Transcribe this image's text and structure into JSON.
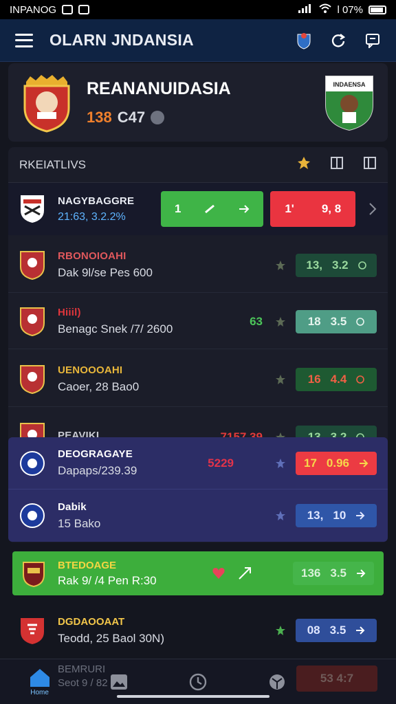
{
  "status_bar": {
    "left_text": "INPANOG",
    "right_text": "l 07%"
  },
  "app_bar": {
    "title": "OLARN JNDANSIA"
  },
  "team_card": {
    "name": "REANANUIDASIA",
    "stat_a": "138",
    "stat_b": "C47",
    "flag_label": "INDAENSA"
  },
  "panel": {
    "title": "RKEIATLIVS",
    "featured": {
      "name": "NAGYBAGGRE",
      "sub": "21:63, 3.2.2%",
      "odds_green": "1",
      "odds_red_a": "1'",
      "odds_red_b": "9, 8"
    },
    "matches": [
      {
        "name": "RBONOIOAHI",
        "name_color": "#e0585c",
        "detail": "Dak 9l/se Pes 600",
        "extra": "",
        "odds_a": "13,",
        "odds_b": "3.2",
        "box_color": "#1d4a38",
        "text_color": "#9ad99e"
      },
      {
        "name": "Hiiil)",
        "name_color": "#e0363c",
        "detail": "Benagc Snek /7/ 2600",
        "extra": "63",
        "odds_a": "18",
        "odds_b": "3.5",
        "box_color": "#4f9d86",
        "text_color": "#e6f4ee"
      },
      {
        "name": "UENOOOAHI",
        "name_color": "#e8b63a",
        "detail": "Caoer, 28 Bao0",
        "extra": "",
        "odds_a": "16",
        "odds_b": "4.4",
        "box_color": "#1e5a32",
        "text_color": "#f06045"
      },
      {
        "name": "PEAVIKI",
        "name_color": "#c8cad2",
        "detail": "",
        "extra": "7157,39",
        "odds_a": "13",
        "odds_b": "3.2",
        "box_color": "#1d4a38",
        "text_color": "#9ad99e"
      }
    ]
  },
  "panel2": {
    "matches": [
      {
        "name": "DEOGRAGAYE",
        "detail": "Dapaps/239.39",
        "extra": "5229",
        "odds_a": "17",
        "odds_b": "0.96"
      },
      {
        "name": "Dabik",
        "detail": "15 Bako",
        "extra": "",
        "odds_a": "13,",
        "odds_b": "10"
      }
    ]
  },
  "promo": {
    "name": "BTEDOAGE",
    "detail": "Rak 9/ /4 Pen R:30",
    "odds_a": "136",
    "odds_b": "3.5"
  },
  "bottom_match": {
    "name": "DGDAOOAAT",
    "detail": "Teodd, 25 Baol 30N)",
    "odds_a": "08",
    "odds_b": "3.5"
  },
  "bottom_nav": {
    "home_label": "Home",
    "peek_name": "BEMRURI",
    "peek_detail": "Seot 9 / 82",
    "peek_odds": "53 4:7"
  }
}
